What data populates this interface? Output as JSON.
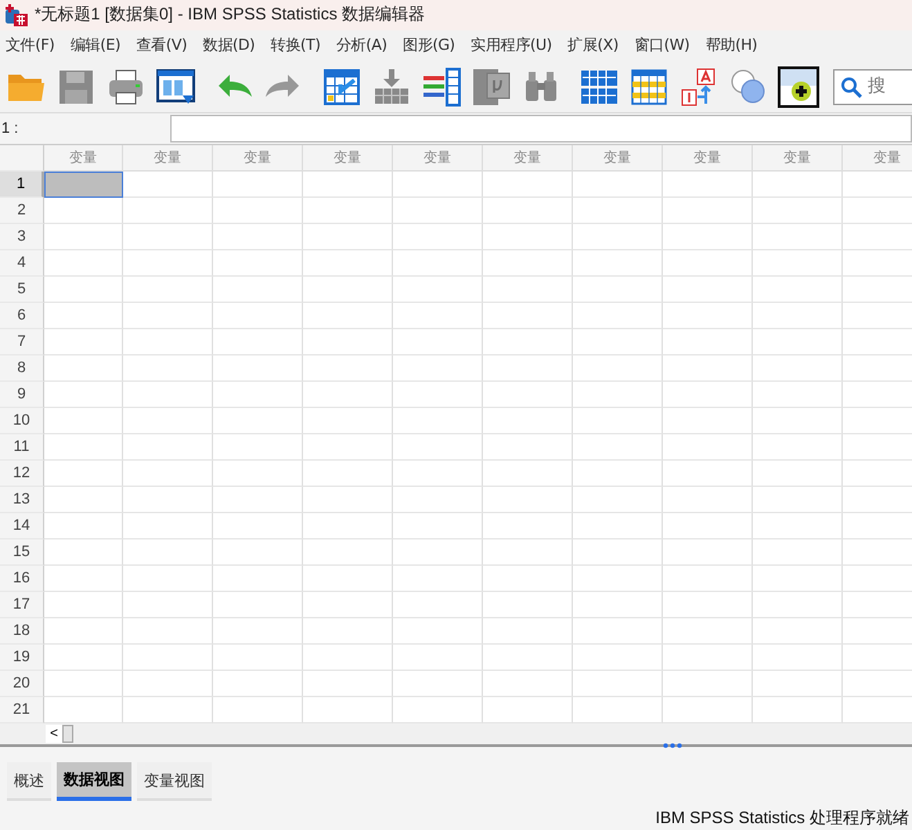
{
  "window": {
    "title": "*无标题1 [数据集0] - IBM SPSS Statistics 数据编辑器"
  },
  "menu": [
    "文件(F)",
    "编辑(E)",
    "查看(V)",
    "数据(D)",
    "转换(T)",
    "分析(A)",
    "图形(G)",
    "实用程序(U)",
    "扩展(X)",
    "窗口(W)",
    "帮助(H)"
  ],
  "toolbar": [
    {
      "kind": "open",
      "disabled": false
    },
    {
      "kind": "save",
      "disabled": true
    },
    {
      "kind": "print",
      "disabled": false
    },
    {
      "kind": "dialog",
      "disabled": false
    },
    {
      "kind": "undo",
      "disabled": false
    },
    {
      "kind": "redo",
      "disabled": true
    },
    {
      "kind": "goto-case",
      "disabled": false
    },
    {
      "kind": "insert-case",
      "disabled": true
    },
    {
      "kind": "variables",
      "disabled": false
    },
    {
      "kind": "run-descriptives",
      "disabled": true
    },
    {
      "kind": "find",
      "disabled": true
    },
    {
      "kind": "split",
      "disabled": false
    },
    {
      "kind": "select-cases",
      "disabled": false
    },
    {
      "kind": "value-labels",
      "disabled": false
    },
    {
      "kind": "sets",
      "disabled": false
    },
    {
      "kind": "add-on",
      "disabled": false
    }
  ],
  "search": {
    "placeholder": "搜"
  },
  "cell_ref": {
    "label": "1 :"
  },
  "grid": {
    "columns": [
      "变量",
      "变量",
      "变量",
      "变量",
      "变量",
      "变量",
      "变量",
      "变量",
      "变量",
      "变量"
    ],
    "rows": [
      {
        "label": "1",
        "selected": true
      },
      {
        "label": "2",
        "selected": false
      },
      {
        "label": "3",
        "selected": false
      },
      {
        "label": "4",
        "selected": false
      },
      {
        "label": "5",
        "selected": false
      },
      {
        "label": "6",
        "selected": false
      },
      {
        "label": "7",
        "selected": false
      },
      {
        "label": "8",
        "selected": false
      },
      {
        "label": "9",
        "selected": false
      },
      {
        "label": "10",
        "selected": false
      },
      {
        "label": "11",
        "selected": false
      },
      {
        "label": "12",
        "selected": false
      },
      {
        "label": "13",
        "selected": false
      },
      {
        "label": "14",
        "selected": false
      },
      {
        "label": "15",
        "selected": false
      },
      {
        "label": "16",
        "selected": false
      },
      {
        "label": "17",
        "selected": false
      },
      {
        "label": "18",
        "selected": false
      },
      {
        "label": "19",
        "selected": false
      },
      {
        "label": "20",
        "selected": false
      },
      {
        "label": "21",
        "selected": false
      }
    ]
  },
  "scroll_arrow": "<",
  "tabs": [
    {
      "label": "概述",
      "selected": false
    },
    {
      "label": "数据视图",
      "selected": true
    },
    {
      "label": "变量视图",
      "selected": false
    }
  ],
  "status_bar": "IBM SPSS Statistics 处理程序就绪"
}
